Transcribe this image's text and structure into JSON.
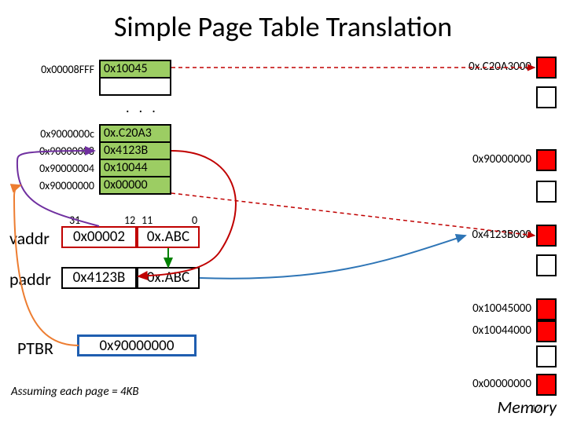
{
  "title": "Simple Page Table Translation",
  "page_table": {
    "top_addr": "0x00008FFF",
    "top_val": "0x10045",
    "ellipsis": ". . .",
    "rows": [
      {
        "addr": "0x9000000c",
        "val": "0x.C20A3"
      },
      {
        "addr": "0x90000008",
        "val": "0x4123B"
      },
      {
        "addr": "0x90000004",
        "val": "0x10044"
      },
      {
        "addr": "0x90000000",
        "val": "0x00000"
      }
    ]
  },
  "memory": {
    "cells": [
      {
        "label": "0x.C20A3000",
        "color": "#ff0000"
      },
      {
        "label": "",
        "color": "#ffffff"
      },
      {
        "label": "0x90000000",
        "color": "#ff0000"
      },
      {
        "label": "",
        "color": "#ffffff"
      },
      {
        "label": "0x4123B000",
        "color": "#ff0000"
      },
      {
        "label": "",
        "color": "#ffffff"
      },
      {
        "label": "0x10045000",
        "color": "#ff0000"
      },
      {
        "label": "0x10044000",
        "color": "#ff0000"
      },
      {
        "label": "",
        "color": "#ffffff"
      },
      {
        "label": "0x00000000",
        "color": "#ff0000"
      }
    ],
    "caption": "Memory"
  },
  "bits": {
    "hi": "31",
    "mid_hi": "12",
    "mid_lo": "11",
    "lo": "0"
  },
  "vaddr": {
    "label": "vaddr",
    "page": "0x00002",
    "off": "0x.ABC"
  },
  "paddr": {
    "label": "paddr",
    "page": "0x4123B",
    "off": "0x.ABC"
  },
  "ptbr": {
    "label": "PTBR",
    "val": "0x90000000"
  },
  "footnote": "Assuming each page = 4KB",
  "pagenum": "17",
  "colors": {
    "vaddr_border": "#c00000",
    "paddr_border": "#000000",
    "ptbr_border": "#1f5eb0",
    "arrow_green": "#008000",
    "arrow_purple": "#7030a0",
    "arrow_orange": "#ed7d31",
    "arrow_red": "#c00000",
    "arrow_blue": "#2e75b6"
  }
}
